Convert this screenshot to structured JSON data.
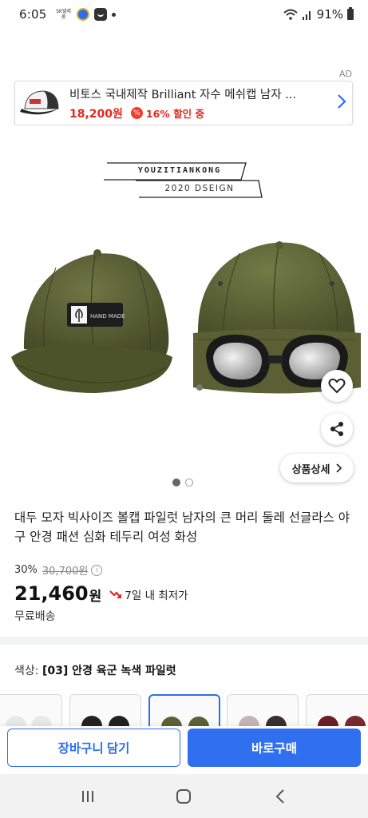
{
  "status_bar": {
    "time": "6:05",
    "carrier_mini": "SK텔레콤",
    "battery": "91%"
  },
  "ad": {
    "tag": "AD",
    "title": "비토스 국내제작 Brilliant 자수 메쉬캡 남자 ...",
    "price": "18,200원",
    "discount_badge": "%",
    "discount_text": "16% 할인 중"
  },
  "product_image": {
    "brand_top": "YOUZITIANKONG",
    "brand_bottom": "2020 DSEIGN",
    "patch_text": "HAND MADE",
    "detail_button": "상품상세",
    "page_count": 2,
    "current_page": 1
  },
  "product": {
    "title": "대두 모자 빅사이즈 볼캡 파일럿 남자의 큰 머리 둘레 선글라스 야구 안경 패션 심화 테두리 여성 화성",
    "discount_rate": "30%",
    "original_price": "30,700원",
    "price": "21,460",
    "price_unit": "원",
    "lowest_text": "7일 내 최저가",
    "shipping": "무료배송"
  },
  "option": {
    "label": "색상: ",
    "selected": "[03] 안경 육군 녹색 파일럿"
  },
  "actions": {
    "cart": "장바구니 담기",
    "buy": "바로구매"
  },
  "colors": {
    "accent": "#2F6FF0",
    "sale_red": "#E0291E",
    "cap_olive": "#5B6135"
  }
}
